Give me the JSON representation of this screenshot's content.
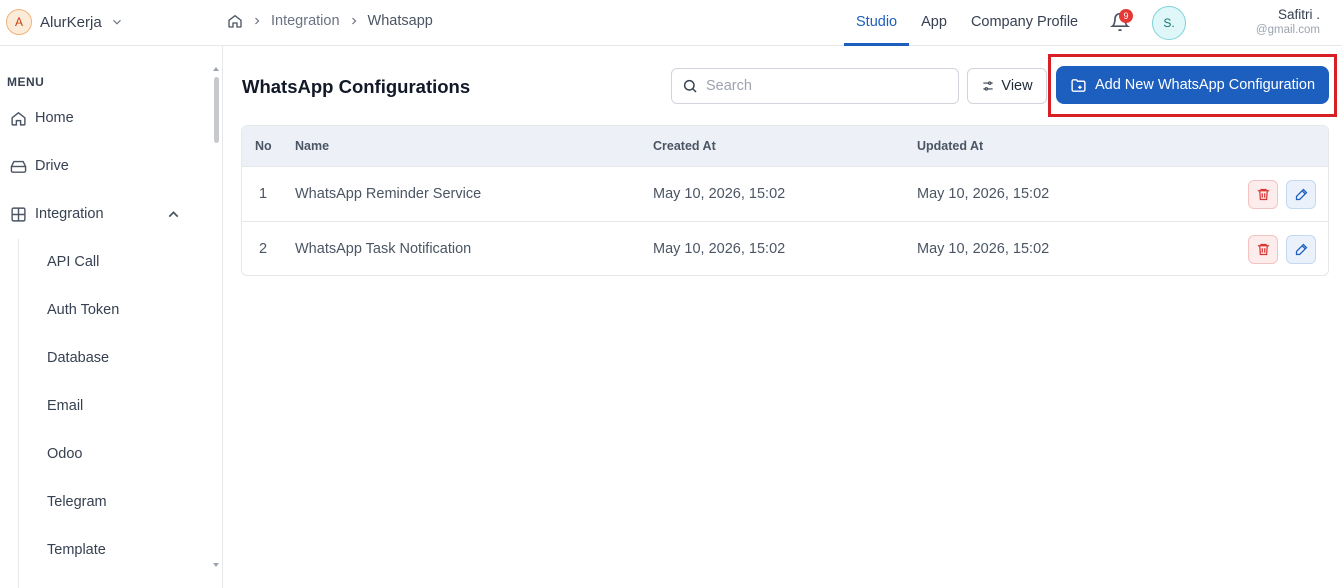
{
  "brand": {
    "initial": "A",
    "name": "AlurKerja"
  },
  "breadcrumb": {
    "items": [
      "Integration",
      "Whatsapp"
    ]
  },
  "topnav": {
    "items": [
      "Studio",
      "App",
      "Company Profile"
    ],
    "active": "Studio"
  },
  "notifications": {
    "count": "9"
  },
  "user": {
    "avatar_initials": "S.",
    "name": "Safitri .",
    "email": "@gmail.com"
  },
  "sidebar": {
    "menu_label": "MENU",
    "items": [
      {
        "label": "Home",
        "icon": "home-icon"
      },
      {
        "label": "Drive",
        "icon": "drive-icon"
      },
      {
        "label": "Integration",
        "icon": "grid-icon",
        "expanded": true
      }
    ],
    "subitems": [
      "API Call",
      "Auth Token",
      "Database",
      "Email",
      "Odoo",
      "Telegram",
      "Template"
    ]
  },
  "page": {
    "title": "WhatsApp Configurations",
    "search_placeholder": "Search",
    "view_label": "View",
    "add_label": "Add New WhatsApp Configuration"
  },
  "table": {
    "columns": [
      "No",
      "Name",
      "Created At",
      "Updated At"
    ],
    "rows": [
      {
        "no": "1",
        "name": "WhatsApp Reminder Service",
        "created": "May 10, 2026, 15:02",
        "updated": "May 10, 2026, 15:02"
      },
      {
        "no": "2",
        "name": "WhatsApp Task Notification",
        "created": "May 10, 2026, 15:02",
        "updated": "May 10, 2026, 15:02"
      }
    ]
  },
  "colors": {
    "primary": "#1d5fbf",
    "highlight": "#d81f26",
    "danger": "#d93636"
  }
}
